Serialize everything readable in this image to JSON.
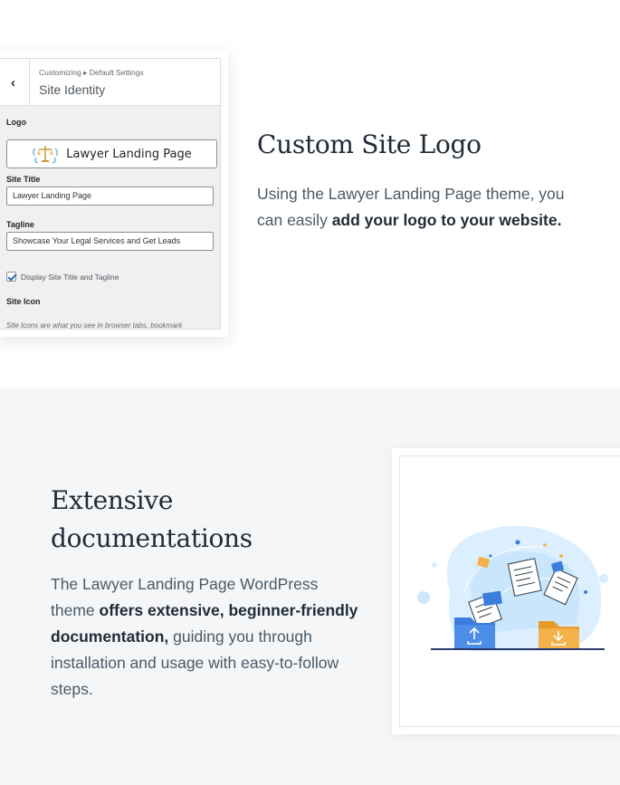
{
  "section1": {
    "customizer": {
      "back_glyph": "‹",
      "breadcrumb": "Customizing ▸ Default Settings",
      "panel_title": "Site Identity",
      "logo_label": "Logo",
      "logo_text": "Lawyer Landing Page",
      "site_title_label": "Site Title",
      "site_title_value": "Lawyer Landing Page",
      "tagline_label": "Tagline",
      "tagline_value": "Showcase Your Legal Services and Get Leads",
      "display_checkbox_label": "Display Site Title and Tagline",
      "display_checkbox_checked": true,
      "site_icon_label": "Site Icon",
      "site_icon_help": "Site Icons are what you see in browser tabs, bookmark"
    },
    "heading": "Custom Site Logo",
    "body_plain": "Using the Lawyer Landing Page theme, you can easily ",
    "body_bold": "add your logo to your website."
  },
  "section2": {
    "heading_line1": "Extensive",
    "heading_line2": "documentations",
    "body_plain1": "The Lawyer Landing Page WordPress theme ",
    "body_bold": "offers extensive, beginner-friendly documentation,",
    "body_plain2": " guiding you through installation and usage with easy-to-follow steps.",
    "illustration": "folders-documents-illustration"
  },
  "colors": {
    "accent_blue": "#3b7ddd",
    "accent_orange": "#f4b24a",
    "section2_bg": "#f4f6f8"
  }
}
